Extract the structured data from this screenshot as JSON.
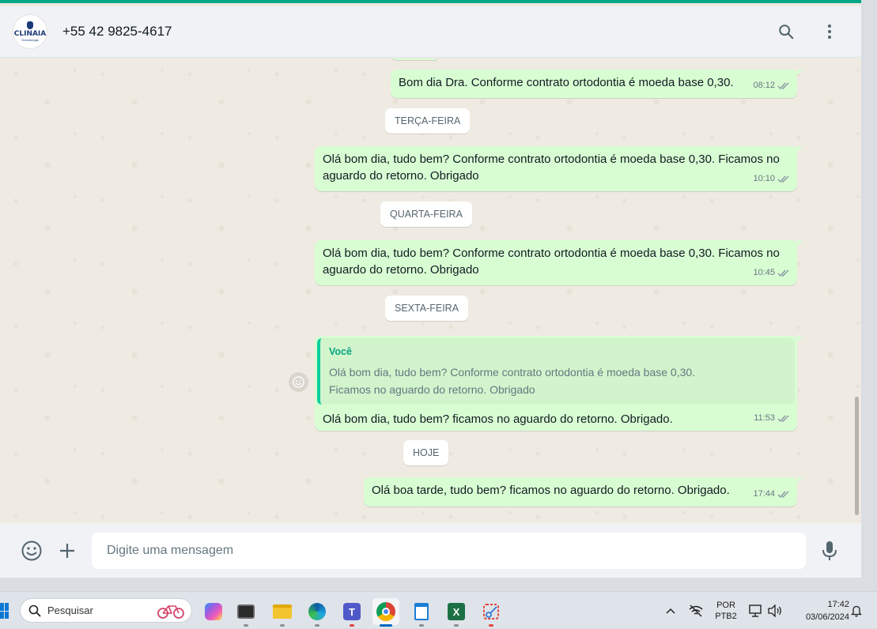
{
  "header": {
    "contact_name": "+55 42 9825-4617",
    "avatar_logo_text": "CLINAIA",
    "avatar_logo_sub": "Odontologia"
  },
  "messages": [
    {
      "text": "Bom dia Dra. Conforme contrato ortodontia é moeda base 0,30.",
      "time": "08:12"
    },
    {
      "text": "Olá bom dia, tudo bem? Conforme contrato ortodontia é moeda base 0,30. Ficamos no aguardo do retorno. Obrigado",
      "time": "10:10"
    },
    {
      "text": "Olá bom dia, tudo bem? Conforme contrato ortodontia é moeda base 0,30. Ficamos no aguardo do retorno. Obrigado",
      "time": "10:45"
    },
    {
      "text": "Olá bom dia, tudo bem? ficamos no aguardo do retorno. Obrigado.",
      "time": "11:53",
      "quote": {
        "author": "Você",
        "text": "Olá bom dia, tudo bem? Conforme contrato ortodontia é moeda base 0,30. Ficamos no aguardo do retorno. Obrigado"
      }
    },
    {
      "text": "Olá boa tarde, tudo bem? ficamos no aguardo do retorno. Obrigado.",
      "time": "17:44"
    }
  ],
  "date_chips": [
    "TERÇA-FEIRA",
    "QUARTA-FEIRA",
    "SEXTA-FEIRA",
    "HOJE"
  ],
  "composer": {
    "placeholder": "Digite uma mensagem"
  },
  "taskbar": {
    "search_label": "Pesquisar",
    "lang_line1": "POR",
    "lang_line2": "PTB2",
    "time": "17:42",
    "date": "03/06/2024",
    "apps": [
      "copilot",
      "terminal",
      "file-explorer",
      "edge",
      "teams",
      "chrome",
      "notepad",
      "excel",
      "snipping-tool"
    ]
  },
  "colors": {
    "accent": "#00a884",
    "outgoing_bubble": "#d9fdd3",
    "chat_bg": "#efeae2",
    "quote_author": "#06a57f"
  }
}
